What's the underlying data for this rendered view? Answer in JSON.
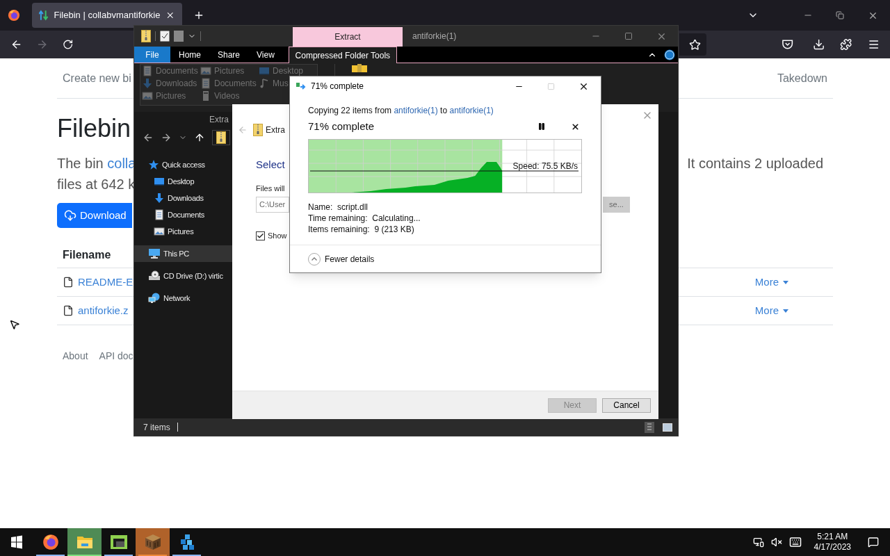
{
  "browser": {
    "tab": {
      "title": "Filebin | collabvmantiforkie",
      "selected": true
    },
    "toolbar": {
      "forward_disabled": true
    },
    "page": {
      "nav_left": "Create new bi",
      "nav_right": "Takedown",
      "heading": "Filebin",
      "intro_start": "The bin",
      "intro_link": "colla",
      "intro_line2": "files at 642 k",
      "intro_right": "It contains 2 uploaded",
      "download_button": "Download",
      "table_header": "Filename",
      "rows": [
        {
          "name": "README-E",
          "action": "More"
        },
        {
          "name": "antiforkie.z",
          "action": "More"
        }
      ],
      "footer": [
        "About",
        "API doc"
      ]
    }
  },
  "explorer": {
    "context_tab": "Extract",
    "title": "antiforkie(1)",
    "ribbon_tabs": [
      {
        "label": "File",
        "kind": "file",
        "selected": false
      },
      {
        "label": "Home",
        "kind": "tab",
        "selected": false
      },
      {
        "label": "Share",
        "kind": "tab",
        "selected": false
      },
      {
        "label": "View",
        "kind": "tab",
        "selected": false
      },
      {
        "label": "Compressed Folder Tools",
        "kind": "tab",
        "selected": true
      }
    ],
    "ribbon_items": [
      {
        "label": "Documents",
        "kind": "document",
        "disabled": true
      },
      {
        "label": "Pictures",
        "kind": "picture",
        "disabled": true
      },
      {
        "label": "Desktop",
        "kind": "desktop",
        "disabled": true
      },
      {
        "label": "Downloads",
        "kind": "download",
        "disabled": true
      },
      {
        "label": "Documents",
        "kind": "document",
        "disabled": true
      },
      {
        "label": "Mus",
        "kind": "music",
        "disabled": true
      },
      {
        "label": "Pictures",
        "kind": "picture",
        "disabled": true
      },
      {
        "label": "Videos",
        "kind": "video",
        "disabled": true
      }
    ],
    "ribbon_group": "Extra",
    "nav_pane": [
      {
        "label": "Quick access",
        "kind": "star",
        "selected": false,
        "children": [
          {
            "label": "Desktop",
            "kind": "desktop",
            "selected": false
          },
          {
            "label": "Downloads",
            "kind": "download",
            "selected": false
          },
          {
            "label": "Documents",
            "kind": "document",
            "selected": false
          },
          {
            "label": "Pictures",
            "kind": "picture",
            "selected": false
          }
        ]
      },
      {
        "label": "This PC",
        "kind": "pc",
        "selected": true
      },
      {
        "label": "CD Drive (D:) virtic",
        "kind": "cd",
        "selected": false
      },
      {
        "label": "Network",
        "kind": "network",
        "selected": false
      }
    ],
    "status": "7 items"
  },
  "extract_wizard": {
    "title": "Extra",
    "heading": "Select",
    "files_label": "Files will",
    "path_value": "C:\\User",
    "browse_button": "se...",
    "show_checkbox": {
      "label": "Show",
      "checked": true
    },
    "next_button": {
      "label": "Next",
      "disabled": true
    },
    "cancel_button": "Cancel"
  },
  "copy_dialog": {
    "title": "71% complete",
    "copy_prefix": "Copying 22 items from",
    "source": "antiforkie(1)",
    "copy_middle": "to",
    "destination": "antiforkie(1)",
    "heading": "71% complete",
    "progress": {
      "level": 0.71
    },
    "speed": "Speed: 75.5 KB/s",
    "details": [
      {
        "label": "Name:",
        "value": "script.dll"
      },
      {
        "label": "Time remaining:",
        "value": "Calculating..."
      },
      {
        "label": "Items remaining:",
        "value": "9 (213 KB)"
      }
    ],
    "toggle": "Fewer details"
  },
  "taskbar": {
    "apps": [
      {
        "kind": "firefox",
        "selected": false,
        "attention": false
      },
      {
        "kind": "folder",
        "selected": true,
        "attention": false
      },
      {
        "kind": "green-app",
        "selected": false,
        "attention": false
      },
      {
        "kind": "crafting-table",
        "selected": false,
        "attention": true
      },
      {
        "kind": "blue-cubes",
        "selected": false,
        "attention": false
      }
    ],
    "time": "5:21 AM",
    "date": "4/17/2023"
  }
}
